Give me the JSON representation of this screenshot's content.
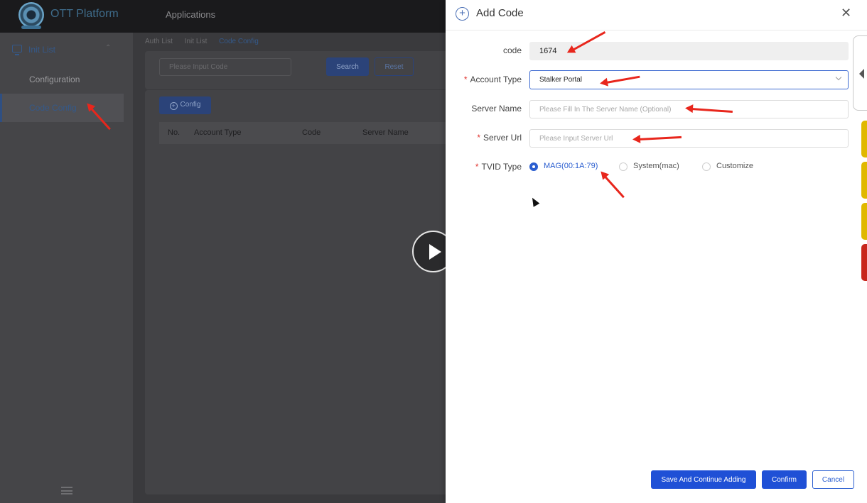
{
  "app": {
    "name": "OTT Platform",
    "menu": "Applications"
  },
  "sidebar": {
    "group_label": "Init List",
    "items": [
      {
        "label": "Configuration",
        "active": false
      },
      {
        "label": "Code Config",
        "active": true
      }
    ]
  },
  "breadcrumb": [
    "Auth List",
    "Init List",
    "Code Config"
  ],
  "filter": {
    "code_placeholder": "Please Input Code",
    "search_label": "Search",
    "reset_label": "Reset"
  },
  "table": {
    "config_button": "Config",
    "columns": [
      "No.",
      "Account Type",
      "Code",
      "Server Name"
    ]
  },
  "drawer": {
    "title": "Add Code",
    "code_label": "code",
    "code_value": "1674",
    "account_type_label": "Account Type",
    "account_type_value": "Stalker Portal",
    "server_name_label": "Server Name",
    "server_name_placeholder": "Please Fill In The Server Name (Optional)",
    "server_url_label": "Server Url",
    "server_url_placeholder": "Please Input Server Url",
    "tvid_type_label": "TVID Type",
    "tvid_options": [
      {
        "label": "MAG(00:1A:79)",
        "checked": true
      },
      {
        "label": "System(mac)",
        "checked": false
      },
      {
        "label": "Customize",
        "checked": false
      }
    ],
    "save_continue_label": "Save And Continue Adding",
    "confirm_label": "Confirm",
    "cancel_label": "Cancel"
  },
  "colors": {
    "primary": "#1f50d6",
    "required": "#e0342f",
    "annotation": "#e8261c",
    "side_tabs": [
      "#e0b800",
      "#e0b800",
      "#e0b800",
      "#c8261c"
    ]
  }
}
